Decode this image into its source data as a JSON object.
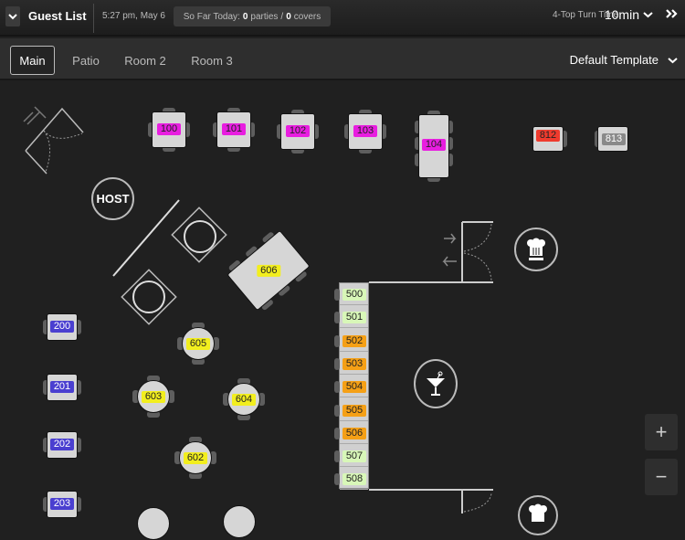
{
  "topbar": {
    "guest_list_label": "Guest List",
    "time": "5:27 pm, May 6",
    "so_far_label": "So Far Today:",
    "parties_count": "0",
    "parties_label": "parties",
    "slash": "/",
    "covers_count": "0",
    "covers_label": "covers",
    "turn_time_label": "4-Top Turn Time:",
    "turn_time_value": "10min",
    "expand_icon": "double-chevron-right-icon"
  },
  "tabs": [
    {
      "label": "Main",
      "active": true
    },
    {
      "label": "Patio",
      "active": false
    },
    {
      "label": "Room 2",
      "active": false
    },
    {
      "label": "Room 3",
      "active": false
    }
  ],
  "template_select": {
    "value": "Default Template"
  },
  "host_label": "HOST",
  "tables": {
    "row100": [
      {
        "id": "100",
        "color": "#e81ee0"
      },
      {
        "id": "101",
        "color": "#e81ee0"
      },
      {
        "id": "102",
        "color": "#e81ee0"
      },
      {
        "id": "103",
        "color": "#e81ee0"
      },
      {
        "id": "104",
        "color": "#e81ee0"
      }
    ],
    "t812": {
      "id": "812",
      "color": "#ef3b2e"
    },
    "t813": {
      "id": "813",
      "color": "#8a8a8a"
    },
    "row200": [
      {
        "id": "200",
        "color": "#4a3fd0"
      },
      {
        "id": "201",
        "color": "#4a3fd0"
      },
      {
        "id": "202",
        "color": "#4a3fd0"
      },
      {
        "id": "203",
        "color": "#4a3fd0"
      }
    ],
    "round600": [
      {
        "id": "602",
        "color": "#f2ee1e"
      },
      {
        "id": "603",
        "color": "#f2ee1e"
      },
      {
        "id": "604",
        "color": "#f2ee1e"
      },
      {
        "id": "605",
        "color": "#f2ee1e"
      }
    ],
    "t606": {
      "id": "606",
      "color": "#f2ee1e"
    },
    "bar500": [
      {
        "id": "500",
        "color": "#d8f7b8"
      },
      {
        "id": "501",
        "color": "#d8f7b8"
      },
      {
        "id": "502",
        "color": "#f5a016"
      },
      {
        "id": "503",
        "color": "#f5a016"
      },
      {
        "id": "504",
        "color": "#f5a016"
      },
      {
        "id": "505",
        "color": "#f5a016"
      },
      {
        "id": "506",
        "color": "#f5a016"
      },
      {
        "id": "507",
        "color": "#d8f7b8"
      },
      {
        "id": "508",
        "color": "#d8f7b8"
      }
    ]
  },
  "zoom": {
    "in_label": "+",
    "out_label": "−"
  }
}
